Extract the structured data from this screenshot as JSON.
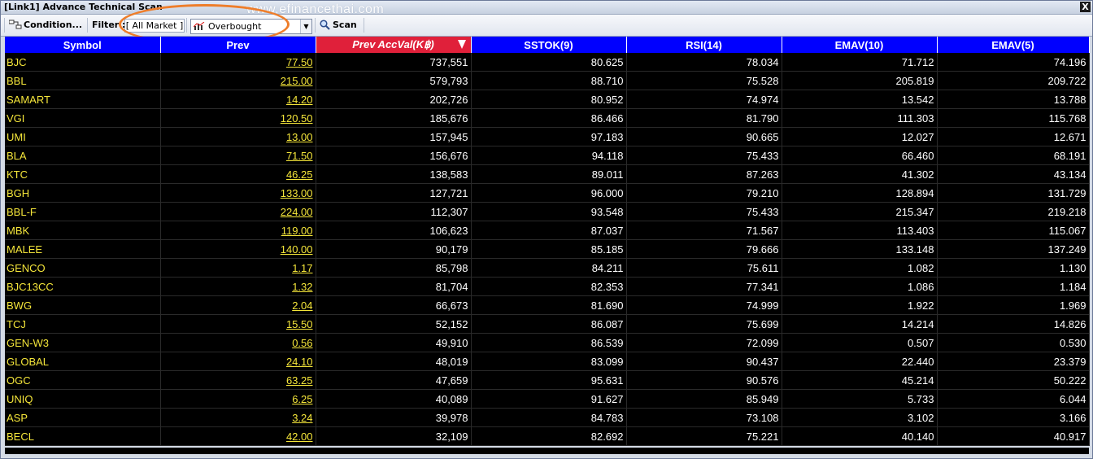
{
  "window": {
    "title": "[Link1] Advance Technical Scan",
    "watermark": "www.efinancethai.com",
    "close_label": "X"
  },
  "toolbar": {
    "condition_label": "Condition...",
    "filter_label": "Filter :",
    "market_value": "[ All Market ]",
    "scan_type_value": "Overbought",
    "scan_label": "Scan",
    "highlight_color": "#ee7d2a"
  },
  "table": {
    "columns": [
      "Symbol",
      "Prev",
      "Prev AccVal(K฿)",
      "SSTOK(9)",
      "RSI(14)",
      "EMAV(10)",
      "EMAV(5)"
    ],
    "sorted_column": "Prev AccVal(K฿)",
    "header_color": "#0000ff",
    "sorted_header_color": "#e0203a",
    "rows": [
      [
        "BJC",
        "77.50",
        "737,551",
        "80.625",
        "78.034",
        "71.712",
        "74.196"
      ],
      [
        "BBL",
        "215.00",
        "579,793",
        "88.710",
        "75.528",
        "205.819",
        "209.722"
      ],
      [
        "SAMART",
        "14.20",
        "202,726",
        "80.952",
        "74.974",
        "13.542",
        "13.788"
      ],
      [
        "VGI",
        "120.50",
        "185,676",
        "86.466",
        "81.790",
        "111.303",
        "115.768"
      ],
      [
        "UMI",
        "13.00",
        "157,945",
        "97.183",
        "90.665",
        "12.027",
        "12.671"
      ],
      [
        "BLA",
        "71.50",
        "156,676",
        "94.118",
        "75.433",
        "66.460",
        "68.191"
      ],
      [
        "KTC",
        "46.25",
        "138,583",
        "89.011",
        "87.263",
        "41.302",
        "43.134"
      ],
      [
        "BGH",
        "133.00",
        "127,721",
        "96.000",
        "79.210",
        "128.894",
        "131.729"
      ],
      [
        "BBL-F",
        "224.00",
        "112,307",
        "93.548",
        "75.433",
        "215.347",
        "219.218"
      ],
      [
        "MBK",
        "119.00",
        "106,623",
        "87.037",
        "71.567",
        "113.403",
        "115.067"
      ],
      [
        "MALEE",
        "140.00",
        "90,179",
        "85.185",
        "79.666",
        "133.148",
        "137.249"
      ],
      [
        "GENCO",
        "1.17",
        "85,798",
        "84.211",
        "75.611",
        "1.082",
        "1.130"
      ],
      [
        "BJC13CC",
        "1.32",
        "81,704",
        "82.353",
        "77.341",
        "1.086",
        "1.184"
      ],
      [
        "BWG",
        "2.04",
        "66,673",
        "81.690",
        "74.999",
        "1.922",
        "1.969"
      ],
      [
        "TCJ",
        "15.50",
        "52,152",
        "86.087",
        "75.699",
        "14.214",
        "14.826"
      ],
      [
        "GEN-W3",
        "0.56",
        "49,910",
        "86.539",
        "72.099",
        "0.507",
        "0.530"
      ],
      [
        "GLOBAL",
        "24.10",
        "48,019",
        "83.099",
        "90.437",
        "22.440",
        "23.379"
      ],
      [
        "OGC",
        "63.25",
        "47,659",
        "95.631",
        "90.576",
        "45.214",
        "50.222"
      ],
      [
        "UNIQ",
        "6.25",
        "40,089",
        "91.627",
        "85.949",
        "5.733",
        "6.044"
      ],
      [
        "ASP",
        "3.24",
        "39,978",
        "84.783",
        "73.108",
        "3.102",
        "3.166"
      ],
      [
        "BECL",
        "42.00",
        "32,109",
        "82.692",
        "75.221",
        "40.140",
        "40.917"
      ]
    ]
  }
}
